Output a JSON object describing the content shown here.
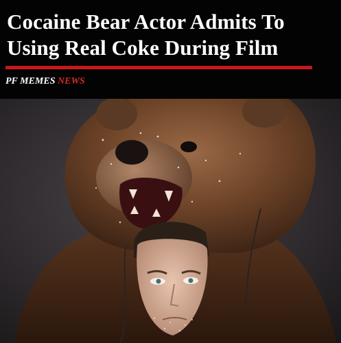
{
  "headline": {
    "line1": "Cocaine Bear Actor Admits To",
    "line2": "Using Real Coke During Film"
  },
  "byline": {
    "brand": "PF MEMES",
    "section": "NEWS"
  },
  "colors": {
    "background": "#030303",
    "headline_text": "#ffffff",
    "rule": "#c7171c",
    "section_text": "#d42a2a"
  }
}
